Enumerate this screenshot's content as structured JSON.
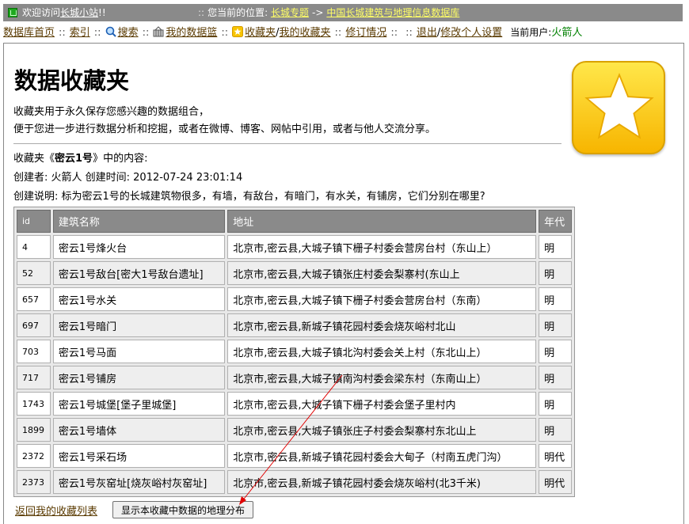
{
  "topbar": {
    "welcome_prefix": "欢迎访问",
    "welcome_link": "长城小站",
    "welcome_suffix": "!!",
    "loc_sep": "::",
    "loc_label": "您当前的位置:",
    "crumb1": "长城专题",
    "crumb_arrow": "->",
    "crumb2": "中国长城建筑与地理信息数据库"
  },
  "nav": {
    "home": "数据库首页",
    "sep": "::",
    "index": "索引",
    "search": "搜索",
    "basket": "我的数据篮",
    "fav1": "收藏夹",
    "slash": "/",
    "fav2": "我的收藏夹",
    "revisions": "修订情况",
    "logout": "退出",
    "profile": "修改个人设置",
    "user_label": "当前用户:",
    "user_name": "火箭人"
  },
  "page": {
    "title": "数据收藏夹",
    "intro1": "收藏夹用于永久保存您感兴趣的数据组合，",
    "intro2": "便于您进一步进行数据分析和挖掘，或者在微博、博客、网帖中引用，或者与他人交流分享。",
    "content_prefix": "收藏夹《",
    "collection_name": "密云1号",
    "content_suffix": "》中的内容:",
    "creator_line": "创建者: 火箭人    创建时间: 2012-07-24 23:01:14",
    "desc_line": "创建说明: 标为密云1号的长城建筑物很多，有墙，有敌台，有暗门，有水关，有铺房，它们分别在哪里?"
  },
  "table": {
    "headers": [
      "id",
      "建筑名称",
      "地址",
      "年代"
    ],
    "rows": [
      [
        "4",
        "密云1号烽火台",
        "北京市,密云县,大城子镇下栅子村委会营房台村（东山上）",
        "明"
      ],
      [
        "52",
        "密云1号敌台[密大1号敌台遗址]",
        "北京市,密云县,大城子镇张庄村委会梨寨村(东山上",
        "明"
      ],
      [
        "657",
        "密云1号水关",
        "北京市,密云县,大城子镇下栅子村委会营房台村（东南）",
        "明"
      ],
      [
        "697",
        "密云1号暗门",
        "北京市,密云县,新城子镇花园村委会烧灰峪村北山",
        "明"
      ],
      [
        "703",
        "密云1号马面",
        "北京市,密云县,大城子镇北沟村委会关上村（东北山上）",
        "明"
      ],
      [
        "717",
        "密云1号铺房",
        "北京市,密云县,大城子镇南沟村委会梁东村（东南山上）",
        "明"
      ],
      [
        "1743",
        "密云1号城堡[堡子里城堡]",
        "北京市,密云县,大城子镇下栅子村委会堡子里村内",
        "明"
      ],
      [
        "1899",
        "密云1号墙体",
        "北京市,密云县,大城子镇张庄子村委会梨寨村东北山上",
        "明"
      ],
      [
        "2372",
        "密云1号采石场",
        "北京市,密云县,新城子镇花园村委会大甸子（村南五虎门沟）",
        "明代"
      ],
      [
        "2373",
        "密云1号灰窑址[烧灰峪村灰窑址]",
        "北京市,密云县,新城子镇花园村委会烧灰峪村(北3千米)",
        "明代"
      ]
    ]
  },
  "footer": {
    "back_link": "返回我的收藏列表",
    "map_button": "显示本收藏中数据的地理分布"
  },
  "colors": {
    "topbar_bg": "#8a8a8a",
    "link_yellow": "#ffff66",
    "link_brown": "#5a3a00",
    "user_green": "#008000",
    "arrow_red": "#e00000",
    "star_gold": "#f7b500"
  }
}
